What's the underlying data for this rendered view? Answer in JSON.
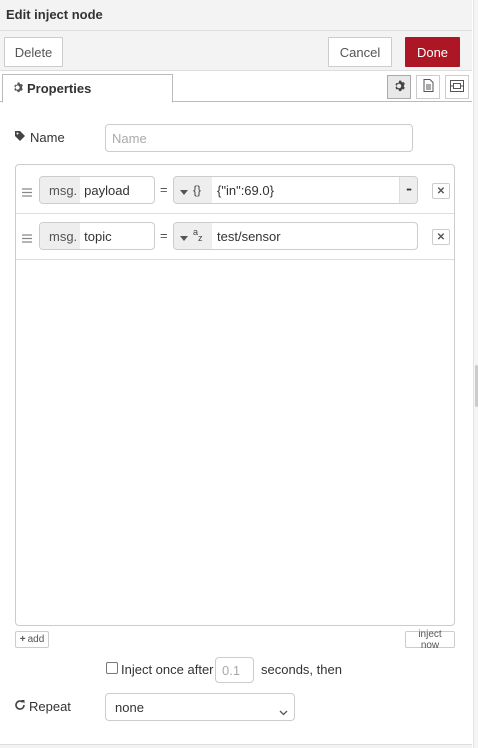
{
  "tray": {
    "title": "Edit inject node"
  },
  "toolbar": {
    "delete_label": "Delete",
    "cancel_label": "Cancel",
    "done_label": "Done",
    "done_color": "#ad1625"
  },
  "tabs": {
    "properties_label": "Properties"
  },
  "form": {
    "name_label": "Name",
    "name_placeholder": "Name",
    "name_value": ""
  },
  "props": [
    {
      "prefix": "msg.",
      "name": "payload",
      "eq": "=",
      "type_glyph": "{}",
      "value": "{\"in\":69.0}",
      "expand": "•••"
    },
    {
      "prefix": "msg.",
      "name": "topic",
      "eq": "=",
      "type_glyph": "az",
      "value": "test/sensor"
    }
  ],
  "actions": {
    "add_label": "add",
    "inject_now_label": "inject now",
    "remove_glyph": "✕"
  },
  "inject_once": {
    "label": "Inject once after",
    "delay_placeholder": "0.1",
    "suffix": "seconds, then",
    "checked": false
  },
  "repeat": {
    "label": "Repeat",
    "selected": "none"
  }
}
